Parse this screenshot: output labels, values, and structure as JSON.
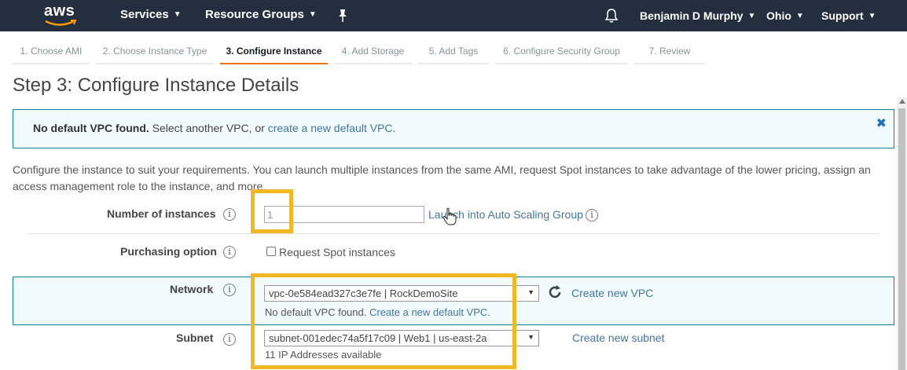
{
  "nav": {
    "logo": "aws",
    "services": "Services",
    "resource_groups": "Resource Groups",
    "user": "Benjamin D Murphy",
    "region": "Ohio",
    "support": "Support"
  },
  "steps": [
    "1. Choose AMI",
    "2. Choose Instance Type",
    "3. Configure Instance",
    "4. Add Storage",
    "5. Add Tags",
    "6. Configure Security Group",
    "7. Review"
  ],
  "active_step": 2,
  "page_title": "Step 3: Configure Instance Details",
  "alert": {
    "bold": "No default VPC found.",
    "text": " Select another VPC, or ",
    "link": "create a new default VPC",
    "tail": ".",
    "close": "✖"
  },
  "description": "Configure the instance to suit your requirements. You can launch multiple instances from the same AMI, request Spot instances to take advantage of the lower pricing, assign an access management role to the instance, and more.",
  "form": {
    "instances": {
      "label": "Number of instances",
      "value": "1",
      "link": "Launch into Auto Scaling Group"
    },
    "purchasing": {
      "label": "Purchasing option",
      "checkbox_label": "Request Spot instances"
    },
    "network": {
      "label": "Network",
      "value": "vpc-0e584ead327c3e7fe | RockDemoSite",
      "note_text": "No default VPC found. ",
      "note_link": "Create a new default VPC",
      "note_tail": ".",
      "link": "Create new VPC"
    },
    "subnet": {
      "label": "Subnet",
      "value": "subnet-001edec74a5f17c09 | Web1 | us-east-2a",
      "note": "11 IP Addresses available",
      "link": "Create new subnet"
    }
  },
  "info_glyph": "i",
  "colors": {
    "nav_bg": "#232f3e",
    "active_step": "#ec7211",
    "link": "#44749d",
    "highlight": "#f2b824",
    "alert_border": "#0e7e9d",
    "alert_bg": "#f1fbfd"
  }
}
